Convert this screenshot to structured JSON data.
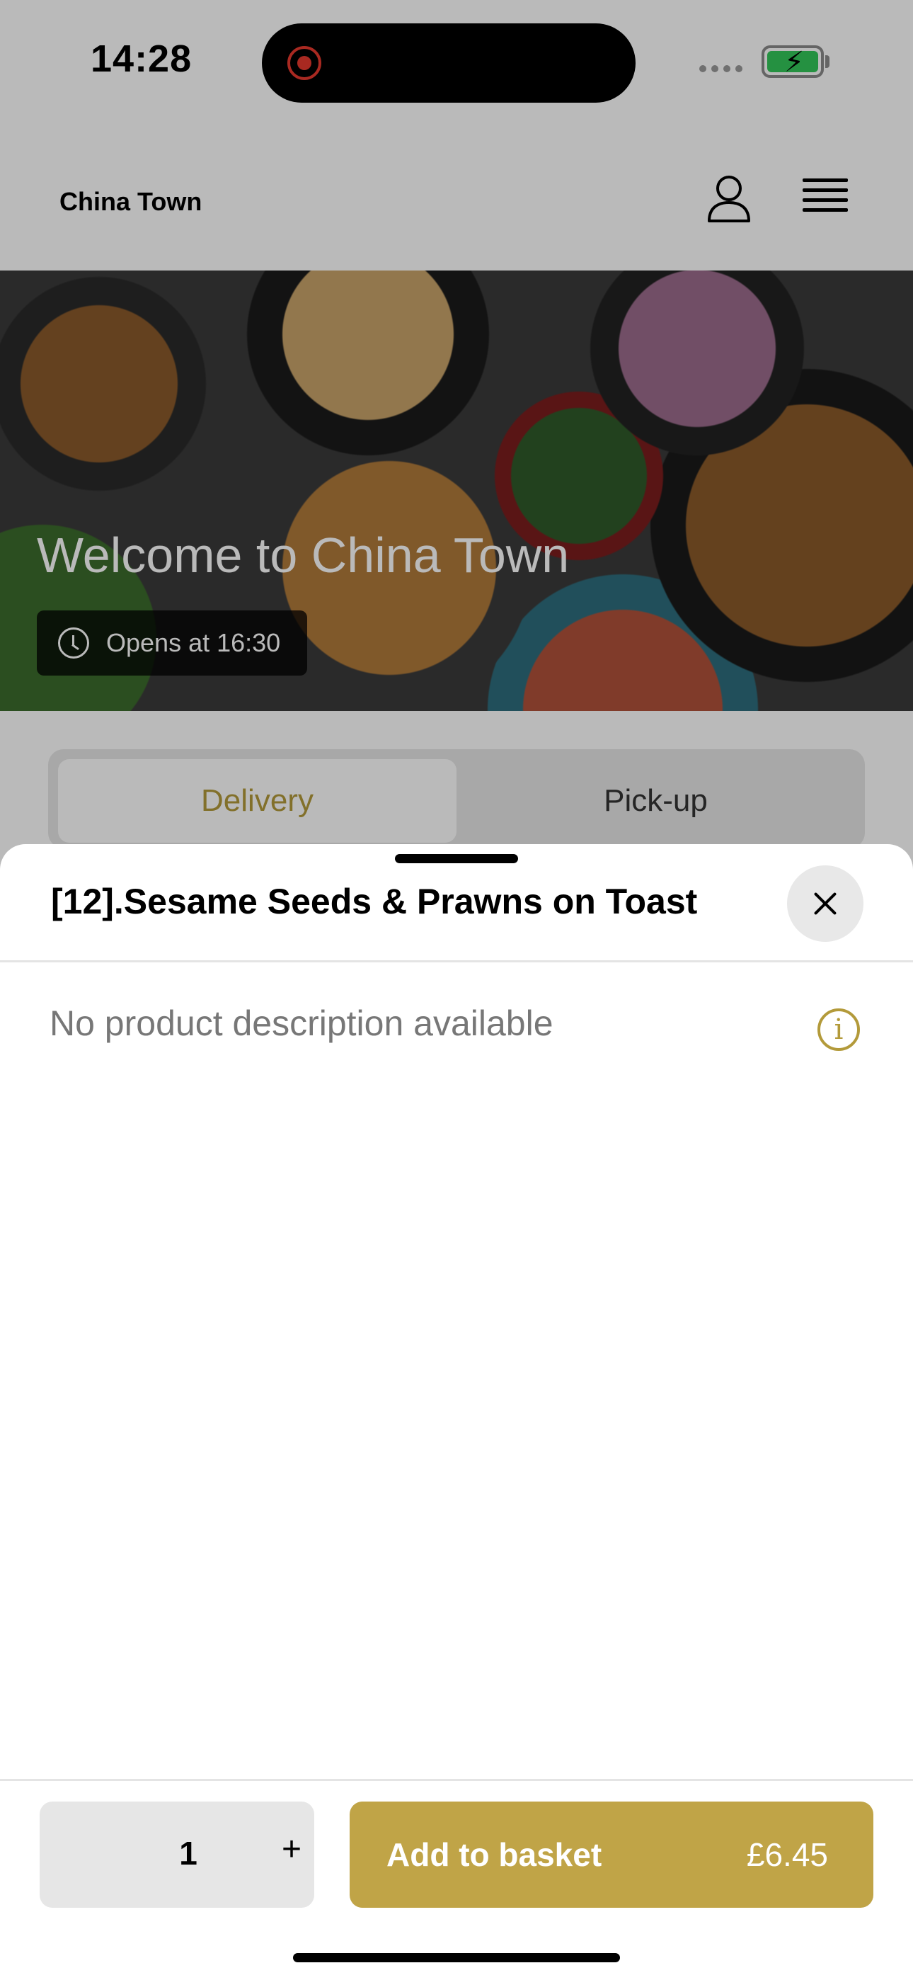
{
  "status_bar": {
    "time": "14:28"
  },
  "header": {
    "restaurant_name": "China Town"
  },
  "hero": {
    "title": "Welcome to China Town",
    "opens_text": "Opens at 16:30"
  },
  "order_tabs": [
    {
      "label": "Delivery",
      "active": true
    },
    {
      "label": "Pick-up",
      "active": false
    }
  ],
  "sheet": {
    "title": "[12].Sesame Seeds & Prawns on Toast",
    "description": "No product description available",
    "quantity": "1",
    "plus_label": "+",
    "add_label": "Add to basket",
    "price": "£6.45"
  },
  "colors": {
    "accent": "#c0a447",
    "accent_text": "#b39a3a"
  },
  "icons": [
    "record-icon",
    "battery-icon",
    "user-icon",
    "hamburger-menu-icon",
    "clock-icon",
    "close-icon",
    "info-icon"
  ]
}
